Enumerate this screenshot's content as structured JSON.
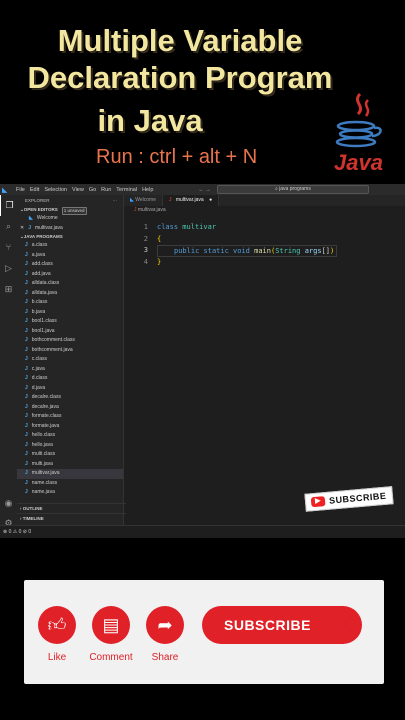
{
  "headline": {
    "line1": "Multiple Variable",
    "line2": "Declaration Program",
    "line3": "in Java"
  },
  "run_hint": "Run : ctrl + alt + N",
  "java_logo_text": "Java",
  "menu": [
    "File",
    "Edit",
    "Selection",
    "View",
    "Go",
    "Run",
    "Terminal",
    "Help"
  ],
  "search_placeholder": "java programs",
  "explorer": {
    "title": "EXPLORER",
    "open_editors_label": "OPEN EDITORS",
    "unsaved_badge": "1 unsaved",
    "open_editors": [
      "Welcome",
      "multivar.java"
    ],
    "folder_label": "JAVA PROGRAMS",
    "files": [
      "a.class",
      "a.java",
      "add.class",
      "add.java",
      "alldata.class",
      "alldata.java",
      "b.class",
      "b.java",
      "bool1.class",
      "bool1.java",
      "bothcomment.class",
      "bothcomment.java",
      "c.class",
      "c.java",
      "d.class",
      "d.java",
      "decalre.class",
      "decalre.java",
      "formate.class",
      "formate.java",
      "hello.class",
      "hello.java",
      "multi.class",
      "multi.java",
      "multivar.java",
      "name.class",
      "name.java"
    ],
    "outline_label": "OUTLINE",
    "timeline_label": "TIMELINE"
  },
  "tabs": [
    {
      "label": "Welcome"
    },
    {
      "label": "multivar.java"
    }
  ],
  "breadcrumb": "multivar.java",
  "code": {
    "line_numbers": [
      "1",
      "2",
      "3",
      "4"
    ],
    "l1_kw": "class",
    "l1_name": "multivar",
    "l2": "{",
    "l3_public": "public",
    "l3_static": "static",
    "l3_void": "void",
    "l3_main": "main",
    "l3_open": "(",
    "l3_type": "String",
    "l3_args": "args",
    "l3_arr": "[]",
    "l3_close": ")",
    "l4": "}"
  },
  "status_text": "⊗ 0 ⚠ 0   ⊘ 0",
  "subscribe_sticker": "SUBSCRIBE",
  "actions": {
    "like": "Like",
    "comment": "Comment",
    "share": "Share",
    "subscribe": "SUBSCRIBE"
  },
  "colors": {
    "accent_red": "#e02128",
    "title_yellow": "#f3e7a0",
    "run_orange": "#e8744d"
  }
}
